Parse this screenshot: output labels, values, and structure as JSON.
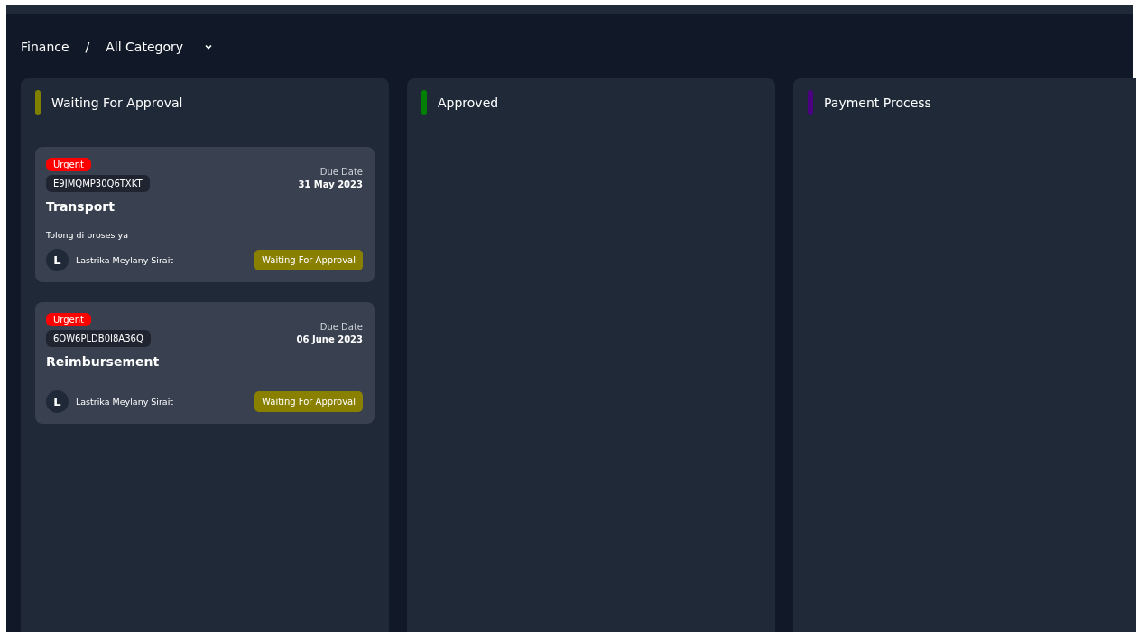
{
  "breadcrumb": {
    "section": "Finance",
    "separator": "/",
    "category": "All Category"
  },
  "columns": [
    {
      "title": "Waiting For Approval",
      "color": "#808000",
      "cards": [
        {
          "priority": "Urgent",
          "code": "E9JMQMP30Q6TXKT",
          "due_label": "Due Date",
          "due_date": "31 May 2023",
          "title": "Transport",
          "note": "Tolong di proses ya",
          "avatar": "L",
          "assignee": "Lastrika Meylany Sirait",
          "status": "Waiting For Approval"
        },
        {
          "priority": "Urgent",
          "code": "6OW6PLDB0I8A36Q",
          "due_label": "Due Date",
          "due_date": "06 June 2023",
          "title": "Reimbursement",
          "avatar": "L",
          "assignee": "Lastrika Meylany Sirait",
          "status": "Waiting For Approval"
        }
      ]
    },
    {
      "title": "Approved",
      "color": "#008000"
    },
    {
      "title": "Payment Process",
      "color": "#4b0082"
    }
  ]
}
